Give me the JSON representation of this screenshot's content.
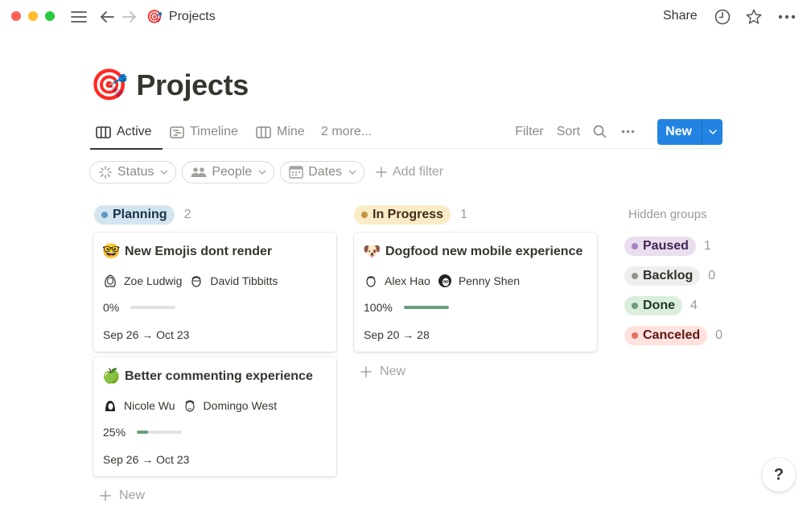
{
  "window": {
    "breadcrumb_emoji": "🎯",
    "breadcrumb_title": "Projects",
    "share_label": "Share"
  },
  "page": {
    "emoji": "🎯",
    "title": "Projects"
  },
  "views": {
    "tabs": [
      {
        "label": "Active",
        "icon": "board-icon",
        "active": true
      },
      {
        "label": "Timeline",
        "icon": "timeline-icon",
        "active": false
      },
      {
        "label": "Mine",
        "icon": "board-icon",
        "active": false
      }
    ],
    "more_label": "2 more...",
    "filter_label": "Filter",
    "sort_label": "Sort",
    "new_label": "New"
  },
  "filters": {
    "chips": [
      {
        "label": "Status",
        "icon": "status-icon"
      },
      {
        "label": "People",
        "icon": "people-icon"
      },
      {
        "label": "Dates",
        "icon": "calendar-icon"
      }
    ],
    "add_filter_label": "Add filter"
  },
  "board": {
    "new_label": "New",
    "groups": [
      {
        "label": "Planning",
        "count": "2",
        "bg": "#d3e5ef",
        "dot": "#5b97bd",
        "text": "#183347",
        "cards": [
          {
            "emoji": "🤓",
            "title": "New Emojis dont  render",
            "people": [
              "Zoe Ludwig",
              "David Tibbitts"
            ],
            "progress_label": "0%",
            "progress": 0,
            "dates": "Sep 26 → Oct 23"
          },
          {
            "emoji": "🍏",
            "title": "Better commenting experience",
            "people": [
              "Nicole Wu",
              "Domingo West"
            ],
            "progress_label": "25%",
            "progress": 25,
            "dates": "Sep 26 → Oct 23"
          }
        ]
      },
      {
        "label": "In Progress",
        "count": "1",
        "bg": "#fbecc8",
        "dot": "#c29343",
        "text": "#402c1b",
        "cards": [
          {
            "emoji": "🐶",
            "title": "Dogfood new mobile experience",
            "people": [
              "Alex Hao",
              "Penny Shen"
            ],
            "progress_label": "100%",
            "progress": 100,
            "dates": "Sep 20 → 28"
          }
        ]
      }
    ],
    "hidden_title": "Hidden groups",
    "hidden_groups": [
      {
        "label": "Paused",
        "count": "1",
        "bg": "#e8deee",
        "dot": "#a782c3",
        "text": "#412454"
      },
      {
        "label": "Backlog",
        "count": "0",
        "bg": "#eeeeed",
        "dot": "#91918e",
        "text": "#32302c"
      },
      {
        "label": "Done",
        "count": "4",
        "bg": "#dbeddb",
        "dot": "#6c9b7d",
        "text": "#1c3829"
      },
      {
        "label": "Canceled",
        "count": "0",
        "bg": "#ffe2dd",
        "dot": "#e16f64",
        "text": "#5d1715"
      }
    ]
  },
  "help_label": "?",
  "colors": {
    "accent": "#2383e2",
    "progress_fill": "#6b9e7c"
  }
}
